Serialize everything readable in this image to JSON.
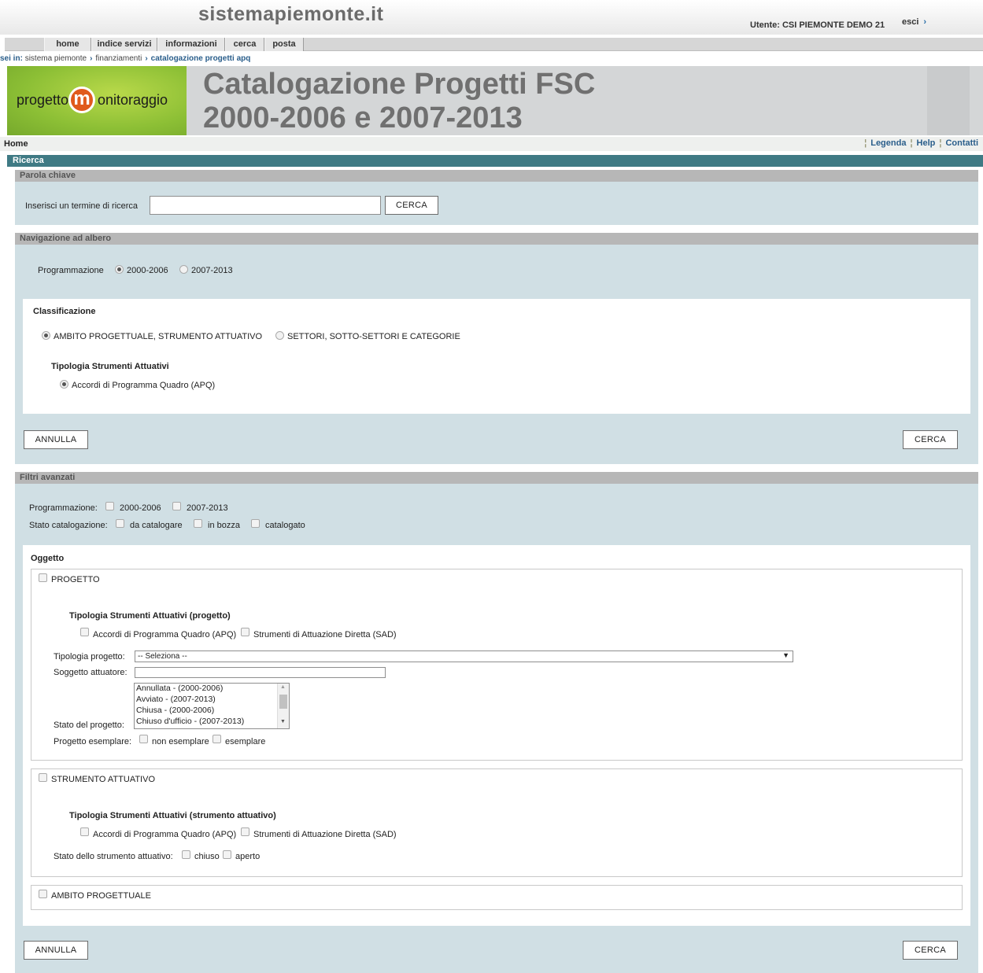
{
  "site": {
    "brand": "sistemapiemonte.it",
    "user_label": "Utente: CSI PIEMONTE DEMO 21",
    "logout_label": "esci",
    "logout_chevron": "›"
  },
  "nav": {
    "tabs": [
      "home",
      "indice servizi",
      "informazioni",
      "cerca",
      "posta"
    ]
  },
  "breadcrumb": {
    "lead": "sei in:",
    "items": [
      "sistema piemonte",
      "finanziamenti",
      "catalogazione progetti apq"
    ]
  },
  "header": {
    "logo_left": "progetto",
    "logo_m": "m",
    "logo_right": "onitoraggio",
    "title_line1": "Catalogazione Progetti FSC",
    "title_line2": "2000-2006 e 2007-2013"
  },
  "subnav": {
    "home": "Home",
    "links": [
      "Legenda",
      "Help",
      "Contatti"
    ]
  },
  "ricerca": {
    "bar_label": "Ricerca"
  },
  "keyword": {
    "heading": "Parola chiave",
    "label": "Inserisci un termine di ricerca",
    "value": "",
    "search_button": "CERCA"
  },
  "tree": {
    "heading": "Navigazione ad albero",
    "programmazione_label": "Programmazione",
    "programmazione_options": [
      "2000-2006",
      "2007-2013"
    ],
    "programmazione_selected": "2000-2006",
    "classificazione_title": "Classificazione",
    "classificazione_options": [
      "AMBITO PROGETTUALE, STRUMENTO ATTUATIVO",
      "SETTORI, SOTTO-SETTORI E CATEGORIE"
    ],
    "classificazione_selected": "AMBITO PROGETTUALE, STRUMENTO ATTUATIVO",
    "tipologia_title": "Tipologia Strumenti Attuativi",
    "tipologia_option": "Accordi di Programma Quadro (APQ)",
    "cancel_button": "ANNULLA",
    "search_button": "CERCA"
  },
  "advanced": {
    "heading": "Filtri avanzati",
    "programmazione_label": "Programmazione:",
    "programmazione_options": [
      "2000-2006",
      "2007-2013"
    ],
    "stato_label": "Stato catalogazione:",
    "stato_options": [
      "da catalogare",
      "in bozza",
      "catalogato"
    ],
    "oggetto_title": "Oggetto",
    "progetto": {
      "label": "PROGETTO",
      "tipologia_title": "Tipologia Strumenti Attuativi (progetto)",
      "tipologia_options": [
        "Accordi di Programma Quadro (APQ)",
        "Strumenti di Attuazione Diretta (SAD)"
      ],
      "tipologia_progetto_label": "Tipologia progetto:",
      "tipologia_progetto_value": "-- Seleziona --",
      "soggetto_label": "Soggetto attuatore:",
      "soggetto_value": "",
      "stato_label": "Stato del progetto:",
      "stato_options": [
        "Annullata - (2000-2006)",
        "Avviato - (2007-2013)",
        "Chiusa - (2000-2006)",
        "Chiuso d'ufficio - (2007-2013)"
      ],
      "esemplare_label": "Progetto esemplare:",
      "esemplare_options": [
        "non esemplare",
        "esemplare"
      ]
    },
    "strumento": {
      "label": "STRUMENTO ATTUATIVO",
      "tipologia_title": "Tipologia Strumenti Attuativi (strumento attuativo)",
      "tipologia_options": [
        "Accordi di Programma Quadro (APQ)",
        "Strumenti di Attuazione Diretta (SAD)"
      ],
      "stato_label": "Stato dello strumento attuativo:",
      "stato_options": [
        "chiuso",
        "aperto"
      ]
    },
    "ambito": {
      "label": "AMBITO PROGETTUALE"
    },
    "cancel_button": "ANNULLA",
    "search_button": "CERCA"
  }
}
